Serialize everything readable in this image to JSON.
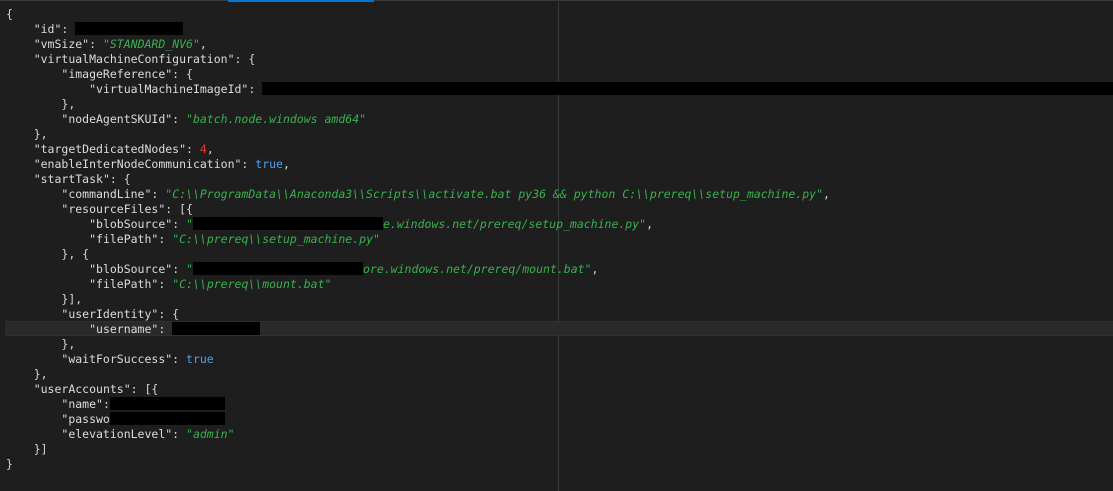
{
  "editor": {
    "lines": [
      {
        "indent": 0,
        "tokens": [
          {
            "t": "p",
            "v": "{"
          }
        ]
      },
      {
        "indent": 1,
        "tokens": [
          {
            "t": "k",
            "v": "\"id\""
          },
          {
            "t": "p",
            "v": ": "
          },
          {
            "t": "redact"
          }
        ]
      },
      {
        "indent": 1,
        "tokens": [
          {
            "t": "k",
            "v": "\"vmSize\""
          },
          {
            "t": "p",
            "v": ": "
          },
          {
            "t": "s",
            "v": "\"STANDARD_NV6\""
          },
          {
            "t": "p",
            "v": ","
          }
        ]
      },
      {
        "indent": 1,
        "tokens": [
          {
            "t": "k",
            "v": "\"virtualMachineConfiguration\""
          },
          {
            "t": "p",
            "v": ": {"
          }
        ]
      },
      {
        "indent": 2,
        "tokens": [
          {
            "t": "k",
            "v": "\"imageReference\""
          },
          {
            "t": "p",
            "v": ": {"
          }
        ]
      },
      {
        "indent": 3,
        "tokens": [
          {
            "t": "k",
            "v": "\"virtualMachineImageId\""
          },
          {
            "t": "p",
            "v": ": "
          },
          {
            "t": "redact"
          }
        ]
      },
      {
        "indent": 2,
        "tokens": [
          {
            "t": "p",
            "v": "},"
          }
        ]
      },
      {
        "indent": 2,
        "tokens": [
          {
            "t": "k",
            "v": "\"nodeAgentSKUId\""
          },
          {
            "t": "p",
            "v": ": "
          },
          {
            "t": "s",
            "v": "\"batch.node.windows amd64\""
          }
        ]
      },
      {
        "indent": 1,
        "tokens": [
          {
            "t": "p",
            "v": "},"
          }
        ]
      },
      {
        "indent": 1,
        "tokens": [
          {
            "t": "k",
            "v": "\"targetDedicatedNodes\""
          },
          {
            "t": "p",
            "v": ": "
          },
          {
            "t": "n",
            "v": "4"
          },
          {
            "t": "p",
            "v": ","
          }
        ]
      },
      {
        "indent": 1,
        "tokens": [
          {
            "t": "k",
            "v": "\"enableInterNodeCommunication\""
          },
          {
            "t": "p",
            "v": ": "
          },
          {
            "t": "b",
            "v": "true"
          },
          {
            "t": "p",
            "v": ","
          }
        ]
      },
      {
        "indent": 1,
        "tokens": [
          {
            "t": "k",
            "v": "\"startTask\""
          },
          {
            "t": "p",
            "v": ": {"
          }
        ]
      },
      {
        "indent": 2,
        "tokens": [
          {
            "t": "k",
            "v": "\"commandLine\""
          },
          {
            "t": "p",
            "v": ": "
          },
          {
            "t": "s",
            "v": "\"C:\\\\ProgramData\\\\Anaconda3\\\\Scripts\\\\activate.bat py36 && python C:\\\\prereq\\\\setup_machine.py\""
          },
          {
            "t": "p",
            "v": ","
          }
        ]
      },
      {
        "indent": 2,
        "tokens": [
          {
            "t": "k",
            "v": "\"resourceFiles\""
          },
          {
            "t": "p",
            "v": ": [{"
          }
        ]
      },
      {
        "indent": 3,
        "tokens": [
          {
            "t": "k",
            "v": "\"blobSource\""
          },
          {
            "t": "p",
            "v": ": "
          },
          {
            "t": "s",
            "v": "\""
          },
          {
            "t": "redact"
          },
          {
            "t": "s",
            "v": "e.windows.net/prereq/setup_machine.py\""
          },
          {
            "t": "p",
            "v": ","
          }
        ]
      },
      {
        "indent": 3,
        "tokens": [
          {
            "t": "k",
            "v": "\"filePath\""
          },
          {
            "t": "p",
            "v": ": "
          },
          {
            "t": "s",
            "v": "\"C:\\\\prereq\\\\setup_machine.py\""
          }
        ]
      },
      {
        "indent": 2,
        "tokens": [
          {
            "t": "p",
            "v": "}, {"
          }
        ]
      },
      {
        "indent": 3,
        "tokens": [
          {
            "t": "k",
            "v": "\"blobSource\""
          },
          {
            "t": "p",
            "v": ": "
          },
          {
            "t": "s",
            "v": "\""
          },
          {
            "t": "redact"
          },
          {
            "t": "s",
            "v": "ore.windows.net/prereq/mount.bat\""
          },
          {
            "t": "p",
            "v": ","
          }
        ]
      },
      {
        "indent": 3,
        "tokens": [
          {
            "t": "k",
            "v": "\"filePath\""
          },
          {
            "t": "p",
            "v": ": "
          },
          {
            "t": "s",
            "v": "\"C:\\\\prereq\\\\mount.bat\""
          }
        ]
      },
      {
        "indent": 2,
        "tokens": [
          {
            "t": "p",
            "v": "}],"
          }
        ]
      },
      {
        "indent": 2,
        "tokens": [
          {
            "t": "k",
            "v": "\"userIdentity\""
          },
          {
            "t": "p",
            "v": ": {"
          }
        ]
      },
      {
        "indent": 3,
        "tokens": [
          {
            "t": "k",
            "v": "\"username\""
          },
          {
            "t": "p",
            "v": ": "
          },
          {
            "t": "redact"
          }
        ]
      },
      {
        "indent": 2,
        "tokens": [
          {
            "t": "p",
            "v": "},"
          }
        ]
      },
      {
        "indent": 2,
        "tokens": [
          {
            "t": "k",
            "v": "\"waitForSuccess\""
          },
          {
            "t": "p",
            "v": ": "
          },
          {
            "t": "b",
            "v": "true"
          }
        ]
      },
      {
        "indent": 1,
        "tokens": [
          {
            "t": "p",
            "v": "},"
          }
        ]
      },
      {
        "indent": 1,
        "tokens": [
          {
            "t": "k",
            "v": "\"userAccounts\""
          },
          {
            "t": "p",
            "v": ": [{"
          }
        ]
      },
      {
        "indent": 2,
        "tokens": [
          {
            "t": "k",
            "v": "\"name\""
          },
          {
            "t": "p",
            "v": ":"
          },
          {
            "t": "redact"
          }
        ]
      },
      {
        "indent": 2,
        "tokens": [
          {
            "t": "k",
            "v": "\"passwo"
          },
          {
            "t": "redact"
          }
        ]
      },
      {
        "indent": 2,
        "tokens": [
          {
            "t": "k",
            "v": "\"elevationLevel\""
          },
          {
            "t": "p",
            "v": ": "
          },
          {
            "t": "s",
            "v": "\"admin\""
          }
        ]
      },
      {
        "indent": 1,
        "tokens": [
          {
            "t": "p",
            "v": "}]"
          }
        ]
      },
      {
        "indent": 0,
        "tokens": [
          {
            "t": "p",
            "v": "}"
          }
        ]
      }
    ]
  },
  "colors": {
    "background": "#1e1e1e",
    "key": "#dcdcdc",
    "string": "#37b24d",
    "number": "#e23a3a",
    "boolean": "#4f9ff0",
    "accent": "#0078d4"
  }
}
